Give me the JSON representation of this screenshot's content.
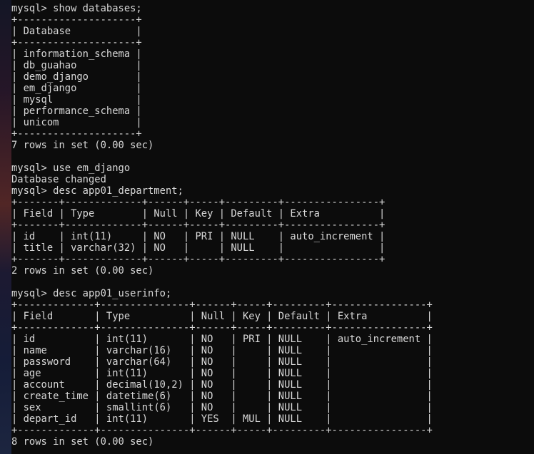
{
  "terminal": {
    "lines": [
      "mysql> show databases;",
      "+--------------------+",
      "| Database           |",
      "+--------------------+",
      "| information_schema |",
      "| db_guahao          |",
      "| demo_django        |",
      "| em_django          |",
      "| mysql              |",
      "| performance_schema |",
      "| unicom             |",
      "+--------------------+",
      "7 rows in set (0.00 sec)",
      "",
      "mysql> use em_django",
      "Database changed",
      "mysql> desc app01_department;",
      "+-------+-------------+------+-----+---------+----------------+",
      "| Field | Type        | Null | Key | Default | Extra          |",
      "+-------+-------------+------+-----+---------+----------------+",
      "| id    | int(11)     | NO   | PRI | NULL    | auto_increment |",
      "| title | varchar(32) | NO   |     | NULL    |                |",
      "+-------+-------------+------+-----+---------+----------------+",
      "2 rows in set (0.00 sec)",
      "",
      "mysql> desc app01_userinfo;",
      "+-------------+---------------+------+-----+---------+----------------+",
      "| Field       | Type          | Null | Key | Default | Extra          |",
      "+-------------+---------------+------+-----+---------+----------------+",
      "| id          | int(11)       | NO   | PRI | NULL    | auto_increment |",
      "| name        | varchar(16)   | NO   |     | NULL    |                |",
      "| password    | varchar(64)   | NO   |     | NULL    |                |",
      "| age         | int(11)       | NO   |     | NULL    |                |",
      "| account     | decimal(10,2) | NO   |     | NULL    |                |",
      "| create_time | datetime(6)   | NO   |     | NULL    |                |",
      "| sex         | smallint(6)   | NO   |     | NULL    |                |",
      "| depart_id   | int(11)       | YES  | MUL | NULL    |                |",
      "+-------------+---------------+------+-----+---------+----------------+",
      "8 rows in set (0.00 sec)"
    ]
  }
}
